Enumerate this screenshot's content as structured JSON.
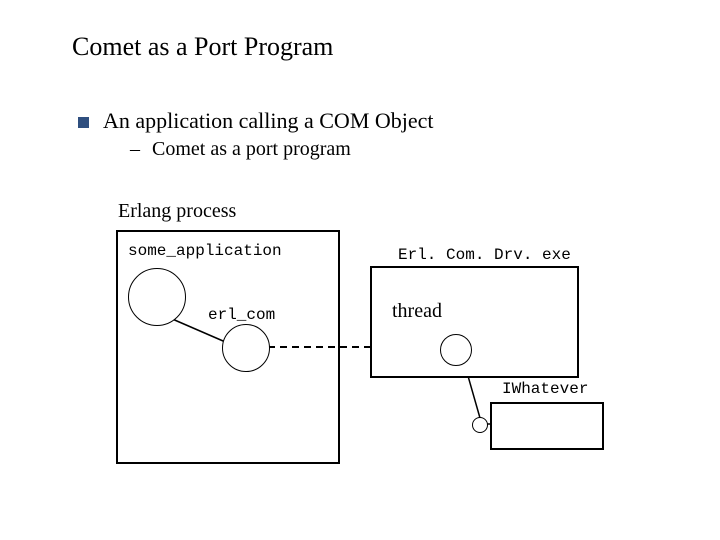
{
  "title": "Comet as a Port Program",
  "bullet": {
    "text": "An application calling a COM Object",
    "sub": "Comet as a port program"
  },
  "diagram": {
    "erlang_process_label": "Erlang process",
    "some_application_label": "some_application",
    "erl_com_label": "erl_com",
    "driver_label": "Erl. Com. Drv. exe",
    "thread_label": "thread",
    "interface_label": "IWhatever"
  }
}
